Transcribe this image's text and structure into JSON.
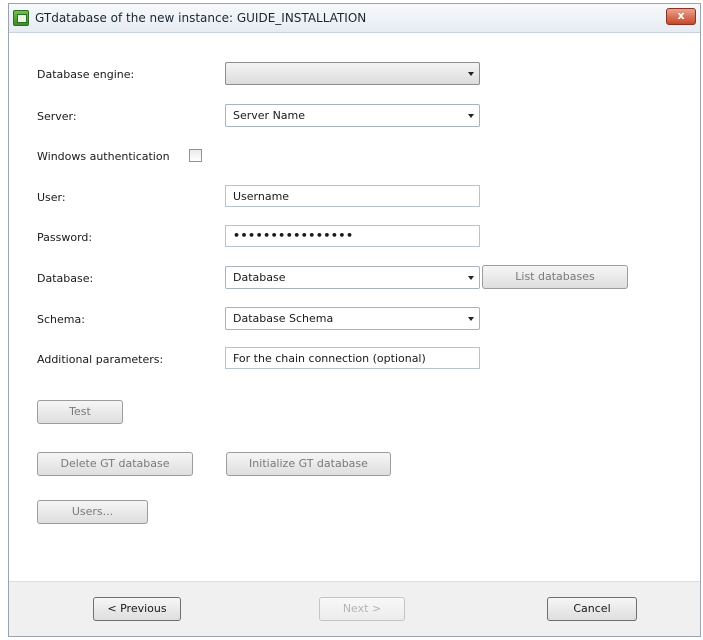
{
  "window": {
    "title": "GTdatabase of the new instance: GUIDE_INSTALLATION",
    "close_label": "x"
  },
  "form": {
    "engine": {
      "label": "Database engine:",
      "value": ""
    },
    "server": {
      "label": "Server:",
      "value": "Server Name"
    },
    "windows_auth": {
      "label": "Windows authentication",
      "checked": false
    },
    "user": {
      "label": "User:",
      "value": "Username"
    },
    "password": {
      "label": "Password:",
      "value": "••••••••••••••••"
    },
    "database": {
      "label": "Database:",
      "value": "Database",
      "list_button": "List databases"
    },
    "schema": {
      "label": "Schema:",
      "value": "Database Schema"
    },
    "additional": {
      "label": "Additional parameters:",
      "value": "For the chain connection (optional)"
    }
  },
  "actions": {
    "test": "Test",
    "delete_db": "Delete GT database",
    "initialize_db": "Initialize GT database",
    "users": "Users..."
  },
  "footer": {
    "previous": "< Previous",
    "next": "Next >",
    "cancel": "Cancel"
  }
}
